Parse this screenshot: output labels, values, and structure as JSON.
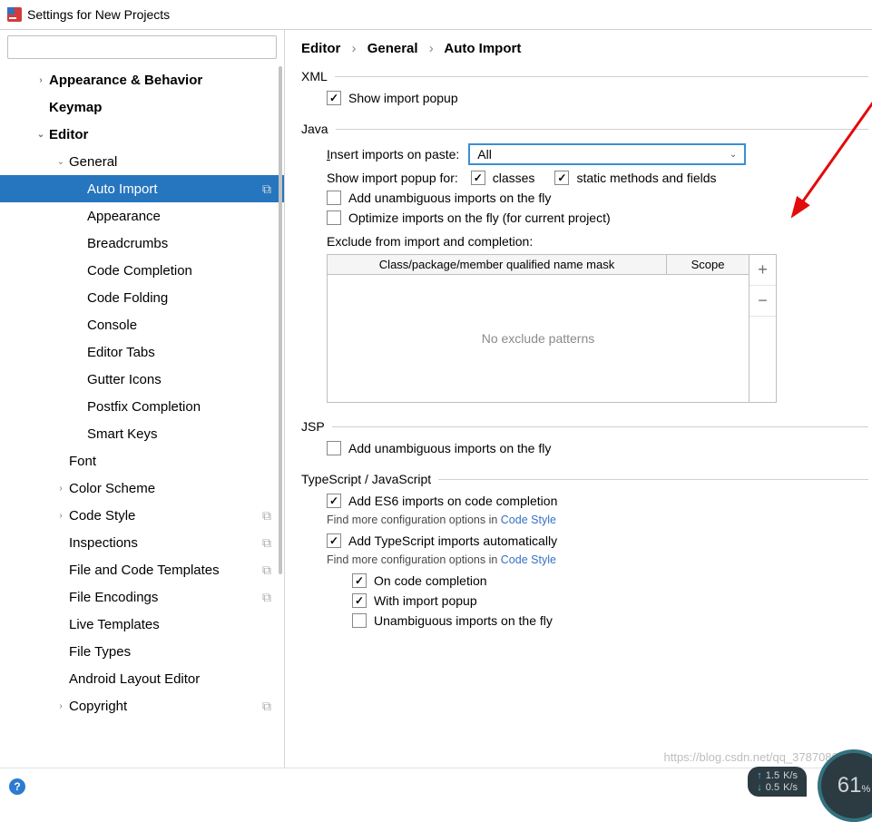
{
  "window": {
    "title": "Settings for New Projects"
  },
  "search": {
    "placeholder": ""
  },
  "sidebar": {
    "items": [
      {
        "label": "Appearance & Behavior",
        "level": 1,
        "bold": true,
        "chev": "right"
      },
      {
        "label": "Keymap",
        "level": 1,
        "bold": true,
        "chev": "none"
      },
      {
        "label": "Editor",
        "level": 1,
        "bold": true,
        "chev": "down"
      },
      {
        "label": "General",
        "level": 2,
        "chev": "down"
      },
      {
        "label": "Auto Import",
        "level": 3,
        "chev": "none",
        "selected": true,
        "copy": true
      },
      {
        "label": "Appearance",
        "level": 3,
        "chev": "none"
      },
      {
        "label": "Breadcrumbs",
        "level": 3,
        "chev": "none"
      },
      {
        "label": "Code Completion",
        "level": 3,
        "chev": "none"
      },
      {
        "label": "Code Folding",
        "level": 3,
        "chev": "none"
      },
      {
        "label": "Console",
        "level": 3,
        "chev": "none"
      },
      {
        "label": "Editor Tabs",
        "level": 3,
        "chev": "none"
      },
      {
        "label": "Gutter Icons",
        "level": 3,
        "chev": "none"
      },
      {
        "label": "Postfix Completion",
        "level": 3,
        "chev": "none"
      },
      {
        "label": "Smart Keys",
        "level": 3,
        "chev": "none"
      },
      {
        "label": "Font",
        "level": 2,
        "chev": "none"
      },
      {
        "label": "Color Scheme",
        "level": 2,
        "chev": "right"
      },
      {
        "label": "Code Style",
        "level": 2,
        "chev": "right",
        "copy": true
      },
      {
        "label": "Inspections",
        "level": 2,
        "chev": "none",
        "copy": true
      },
      {
        "label": "File and Code Templates",
        "level": 2,
        "chev": "none",
        "copy": true
      },
      {
        "label": "File Encodings",
        "level": 2,
        "chev": "none",
        "copy": true
      },
      {
        "label": "Live Templates",
        "level": 2,
        "chev": "none"
      },
      {
        "label": "File Types",
        "level": 2,
        "chev": "none"
      },
      {
        "label": "Android Layout Editor",
        "level": 2,
        "chev": "none"
      },
      {
        "label": "Copyright",
        "level": 2,
        "chev": "right",
        "copy": true
      }
    ]
  },
  "breadcrumb": {
    "a": "Editor",
    "b": "General",
    "c": "Auto Import"
  },
  "xml": {
    "title": "XML",
    "show_popup": {
      "label": "Show import popup",
      "checked": true
    }
  },
  "java": {
    "title": "Java",
    "insert_label": "Insert imports on paste:",
    "insert_value": "All",
    "popup_label": "Show import popup for:",
    "classes": {
      "label": "classes",
      "checked": true
    },
    "static": {
      "label": "static methods and fields",
      "checked": true
    },
    "unambig": {
      "label": "Add unambiguous imports on the fly",
      "checked": false
    },
    "optimize": {
      "label": "Optimize imports on the fly (for current project)",
      "checked": false
    },
    "exclude_label": "Exclude from import and completion:",
    "table": {
      "col1": "Class/package/member qualified name mask",
      "col2": "Scope",
      "empty": "No exclude patterns"
    }
  },
  "jsp": {
    "title": "JSP",
    "unambig": {
      "label": "Add unambiguous imports on the fly",
      "checked": false
    }
  },
  "ts": {
    "title": "TypeScript / JavaScript",
    "es6": {
      "label": "Add ES6 imports on code completion",
      "checked": true
    },
    "hint1a": "Find more configuration options in ",
    "hint1b": "Code Style",
    "tslabel": {
      "label": "Add TypeScript imports automatically",
      "checked": true
    },
    "hint2a": "Find more configuration options in ",
    "hint2b": "Code Style",
    "sub1": {
      "label": "On code completion",
      "checked": true
    },
    "sub2": {
      "label": "With import popup",
      "checked": true
    },
    "sub3": {
      "label": "Unambiguous imports on the fly",
      "checked": false
    }
  },
  "watermark": "https://blog.csdn.net/qq_37870869",
  "gauge": {
    "value": "61",
    "pct": "%",
    "up": "1.5",
    "up_unit": "K/s",
    "dn": "0.5",
    "dn_unit": "K/s"
  }
}
